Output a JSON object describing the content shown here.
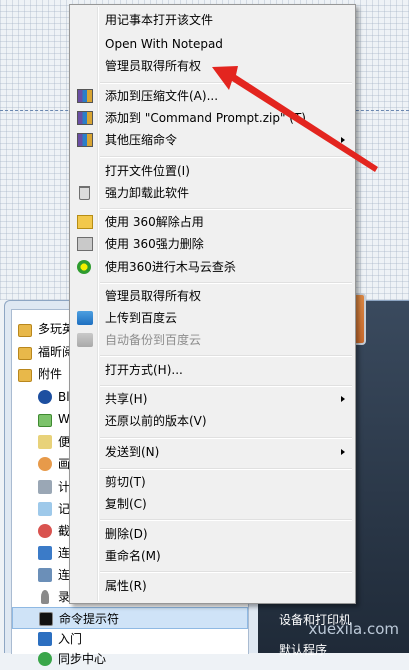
{
  "context_menu": {
    "items": [
      {
        "label": "用记事本打开该文件"
      },
      {
        "label": "Open With Notepad"
      },
      {
        "label": "管理员取得所有权"
      },
      {
        "label": "添加到压缩文件(A)..."
      },
      {
        "label": "添加到 \"Command Prompt.zip\" (T)"
      },
      {
        "label": "其他压缩命令"
      },
      {
        "label": "打开文件位置(I)"
      },
      {
        "label": "强力卸载此软件"
      },
      {
        "label": "使用 360解除占用"
      },
      {
        "label": "使用 360强力删除"
      },
      {
        "label": "使用360进行木马云查杀"
      },
      {
        "label": "管理员取得所有权"
      },
      {
        "label": "上传到百度云"
      },
      {
        "label": "自动备份到百度云"
      },
      {
        "label": "打开方式(H)..."
      },
      {
        "label": "共享(H)"
      },
      {
        "label": "还原以前的版本(V)"
      },
      {
        "label": "发送到(N)"
      },
      {
        "label": "剪切(T)"
      },
      {
        "label": "复制(C)"
      },
      {
        "label": "删除(D)"
      },
      {
        "label": "重命名(M)"
      },
      {
        "label": "属性(R)"
      }
    ]
  },
  "start_menu": {
    "programs": [
      {
        "label": "多玩英"
      },
      {
        "label": "福昕阅"
      },
      {
        "label": "附件"
      },
      {
        "label": "Blu"
      },
      {
        "label": "Wi"
      },
      {
        "label": "便"
      },
      {
        "label": "画图"
      },
      {
        "label": "计算"
      },
      {
        "label": "记事"
      },
      {
        "label": "截图"
      },
      {
        "label": "连接"
      },
      {
        "label": "连接"
      },
      {
        "label": "录音"
      },
      {
        "label": "命令提示符"
      },
      {
        "label": "入门"
      },
      {
        "label": "同步中心"
      }
    ],
    "right_panel": {
      "devices": "设备和打印机",
      "default_programs": "默认程序"
    }
  },
  "watermark": "xuexila.com"
}
